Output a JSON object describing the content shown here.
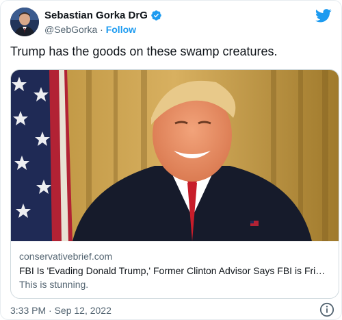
{
  "author": {
    "name": "Sebastian Gorka DrG",
    "handle": "@SebGorka",
    "separator": "·",
    "follow_label": "Follow"
  },
  "tweet": {
    "text": "Trump has the goods on these swamp creatures."
  },
  "card": {
    "domain": "conservativebrief.com",
    "title": "FBI Is 'Evading Donald Trump,' Former Clinton Advisor Says FBI is Frightened",
    "description": "This is stunning."
  },
  "footer": {
    "timestamp": "3:33 PM · Sep 12, 2022"
  },
  "icons": {
    "verified": "verified-badge-icon",
    "brand": "twitter-bird-icon",
    "info": "info-icon"
  },
  "colors": {
    "accent": "#1d9bf0",
    "secondary_text": "#536471",
    "primary_text": "#0f1419",
    "border": "#cfd9de"
  }
}
